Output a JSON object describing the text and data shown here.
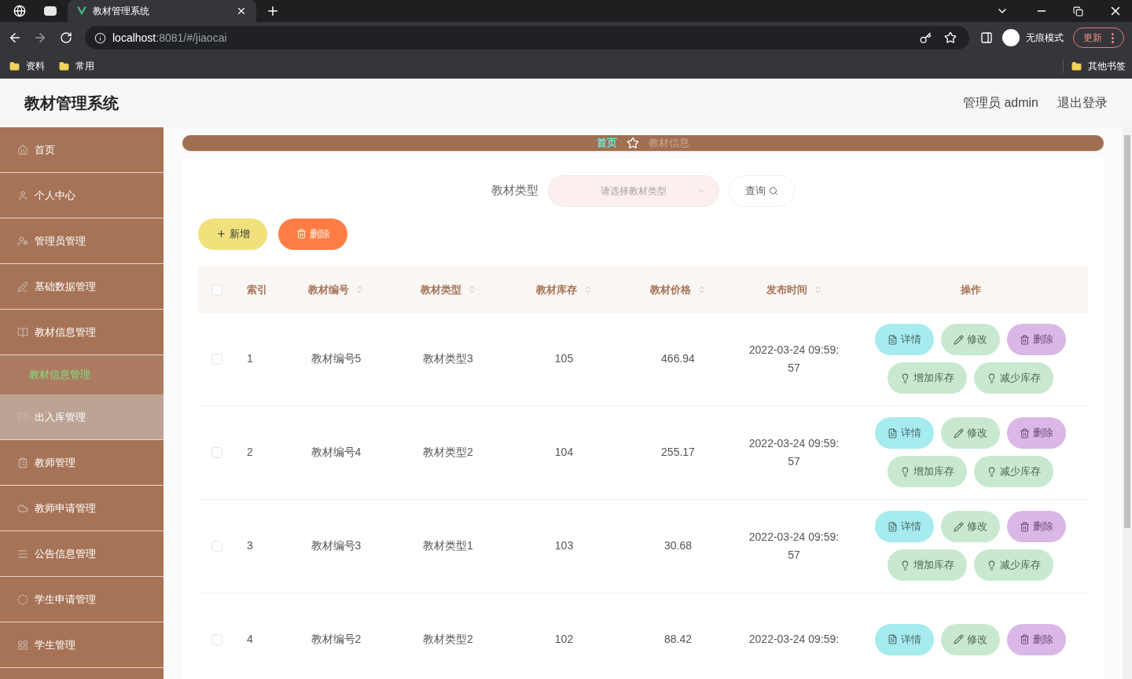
{
  "browser": {
    "tab_title": "教材管理系统",
    "url_host": "localhost",
    "url_rest": ":8081/#/jiaocai",
    "incognito": "无痕模式",
    "update": "更新",
    "bookmarks": [
      "资料",
      "常用"
    ],
    "other_bookmarks": "其他书签"
  },
  "header": {
    "title": "教材管理系统",
    "user": "管理员 admin",
    "logout": "退出登录"
  },
  "sidebar": {
    "items": [
      {
        "label": "首页",
        "hovered": false
      },
      {
        "label": "个人中心",
        "hovered": false
      },
      {
        "label": "管理员管理",
        "hovered": false
      },
      {
        "label": "基础数据管理",
        "hovered": false
      },
      {
        "label": "教材信息管理",
        "hovered": false,
        "children": [
          {
            "label": "教材信息管理",
            "selected": true
          }
        ]
      },
      {
        "label": "出入库管理",
        "hovered": true
      },
      {
        "label": "教师管理",
        "hovered": false
      },
      {
        "label": "教师申请管理",
        "hovered": false
      },
      {
        "label": "公告信息管理",
        "hovered": false
      },
      {
        "label": "学生申请管理",
        "hovered": false
      },
      {
        "label": "学生管理",
        "hovered": false
      }
    ]
  },
  "breadcrumb": [
    "首页",
    "教材信息"
  ],
  "search": {
    "label": "教材类型",
    "placeholder": "请选择教材类型",
    "button": "查询"
  },
  "toolbar": [
    {
      "kind": "add",
      "label": "新增"
    },
    {
      "kind": "delete",
      "label": "删除"
    }
  ],
  "table": {
    "select_all_checked": false,
    "columns": [
      {
        "label": "索引",
        "sortable": false
      },
      {
        "label": "教材编号",
        "sortable": true
      },
      {
        "label": "教材类型",
        "sortable": true
      },
      {
        "label": "教材库存",
        "sortable": true
      },
      {
        "label": "教材价格",
        "sortable": true
      },
      {
        "label": "发布时间",
        "sortable": true
      },
      {
        "label": "操作",
        "sortable": false
      }
    ],
    "rows": [
      {
        "checked": false,
        "cells": [
          "1",
          "教材编号5",
          "教材类型3",
          "105",
          "466.94",
          "2022-03-24 09:59:57"
        ],
        "actions": [
          {
            "kind": "detail",
            "label": "详情"
          },
          {
            "kind": "edit",
            "label": "修改"
          },
          {
            "kind": "delete",
            "label": "删除"
          },
          {
            "kind": "add_stock",
            "label": "增加库存"
          },
          {
            "kind": "reduce_stock",
            "label": "减少库存"
          }
        ]
      },
      {
        "checked": false,
        "cells": [
          "2",
          "教材编号4",
          "教材类型2",
          "104",
          "255.17",
          "2022-03-24 09:59:57"
        ],
        "actions": [
          {
            "kind": "detail",
            "label": "详情"
          },
          {
            "kind": "edit",
            "label": "修改"
          },
          {
            "kind": "delete",
            "label": "删除"
          },
          {
            "kind": "add_stock",
            "label": "增加库存"
          },
          {
            "kind": "reduce_stock",
            "label": "减少库存"
          }
        ]
      },
      {
        "checked": false,
        "cells": [
          "3",
          "教材编号3",
          "教材类型1",
          "103",
          "30.68",
          "2022-03-24 09:59:57"
        ],
        "actions": [
          {
            "kind": "detail",
            "label": "详情"
          },
          {
            "kind": "edit",
            "label": "修改"
          },
          {
            "kind": "delete",
            "label": "删除"
          },
          {
            "kind": "add_stock",
            "label": "增加库存"
          },
          {
            "kind": "reduce_stock",
            "label": "减少库存"
          }
        ]
      },
      {
        "checked": false,
        "cells": [
          "4",
          "教材编号2",
          "教材类型2",
          "102",
          "88.42",
          "2022-03-24 09:59:"
        ],
        "actions": [
          {
            "kind": "detail",
            "label": "详情"
          },
          {
            "kind": "edit",
            "label": "修改"
          },
          {
            "kind": "delete",
            "label": "删除"
          }
        ]
      }
    ]
  }
}
